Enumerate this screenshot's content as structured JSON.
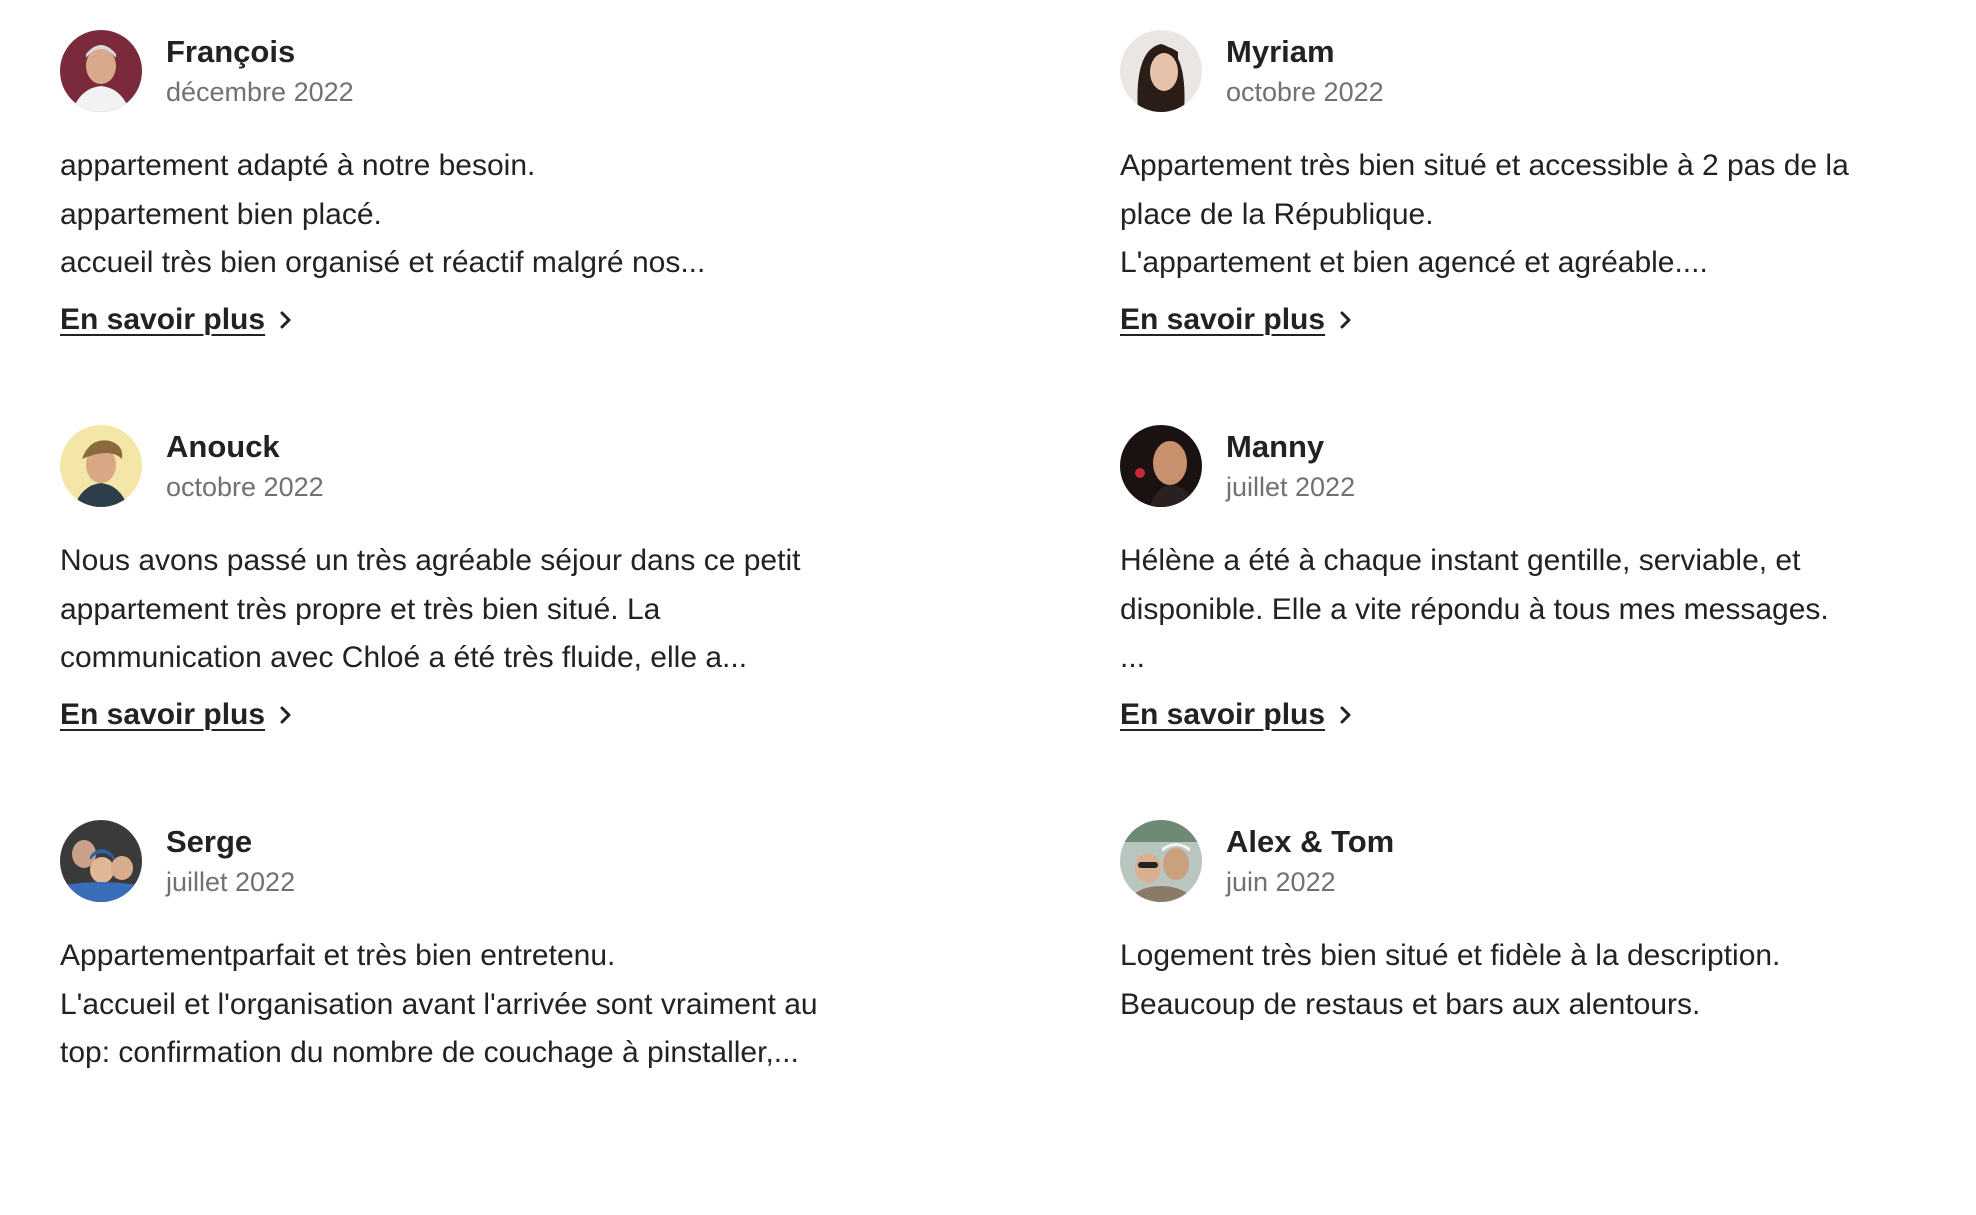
{
  "reviews": [
    {
      "name": "François",
      "date": "décembre 2022",
      "lines": [
        "appartement adapté à notre besoin.",
        "appartement bien placé.",
        "accueil très bien organisé et réactif malgré nos..."
      ],
      "more_label": "En savoir plus",
      "avatar_icon": "person-photo-icon"
    },
    {
      "name": "Myriam",
      "date": "octobre 2022",
      "lines": [
        "Appartement très bien situé et accessible à 2 pas de la",
        "place de la République.",
        "L'appartement et bien agencé et agréable...."
      ],
      "more_label": "En savoir plus",
      "avatar_icon": "person-photo-icon"
    },
    {
      "name": "Anouck",
      "date": "octobre 2022",
      "lines": [
        "Nous avons passé un très agréable séjour dans ce petit",
        "appartement très propre et très bien situé. La",
        "communication avec Chloé a été très fluide, elle a..."
      ],
      "more_label": "En savoir plus",
      "avatar_icon": "person-photo-icon"
    },
    {
      "name": "Manny",
      "date": "juillet 2022",
      "lines": [
        "Hélène a été à chaque instant gentille, serviable, et",
        "disponible. Elle a vite répondu à tous mes messages.",
        "..."
      ],
      "more_label": "En savoir plus",
      "avatar_icon": "person-photo-icon"
    },
    {
      "name": "Serge",
      "date": "juillet 2022",
      "lines": [
        "Appartementparfait et très bien entretenu.",
        "L'accueil et l'organisation avant l'arrivée sont vraiment au",
        "top: confirmation du nombre de couchage à pinstaller,..."
      ],
      "more_label": "",
      "avatar_icon": "group-photo-icon"
    },
    {
      "name": "Alex & Tom",
      "date": "juin 2022",
      "lines": [
        "Logement très bien situé et fidèle à la description.",
        "Beaucoup de restaus et bars aux alentours."
      ],
      "more_label": "",
      "avatar_icon": "couple-photo-icon"
    }
  ],
  "icons": {
    "more": "chevron-right-icon"
  },
  "colors": {
    "text": "#222222",
    "muted": "#717171",
    "background": "#ffffff"
  }
}
